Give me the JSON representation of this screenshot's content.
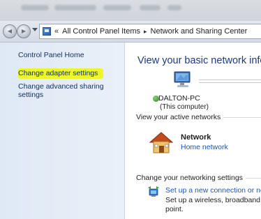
{
  "breadcrumb": {
    "chevron": "«",
    "items": [
      "All Control Panel Items",
      "Network and Sharing Center"
    ],
    "separator": "▸"
  },
  "nav": {
    "back_glyph": "◀",
    "forward_glyph": "▶"
  },
  "left_pane": {
    "home": "Control Panel Home",
    "links": [
      "Change adapter settings",
      "Change advanced sharing",
      "settings"
    ],
    "highlight_color": "#eef51f"
  },
  "main": {
    "title": "View your basic network inform",
    "computer_name": "DALTON-PC",
    "computer_sub": "(This computer)",
    "active_networks_header": "View your active networks",
    "network_name": "Network",
    "network_type": "Home network",
    "change_settings_header": "Change your networking settings",
    "setup_link": "Set up a new connection or net",
    "setup_desc": "Set up a wireless, broadband, di point."
  },
  "colors": {
    "link": "#1a56b0",
    "title": "#1e3a78",
    "pane_bg": "#e4edf7"
  },
  "icons": [
    "back-icon",
    "forward-icon",
    "control-panel-icon",
    "computer-icon",
    "house-icon",
    "setup-connection-icon"
  ]
}
